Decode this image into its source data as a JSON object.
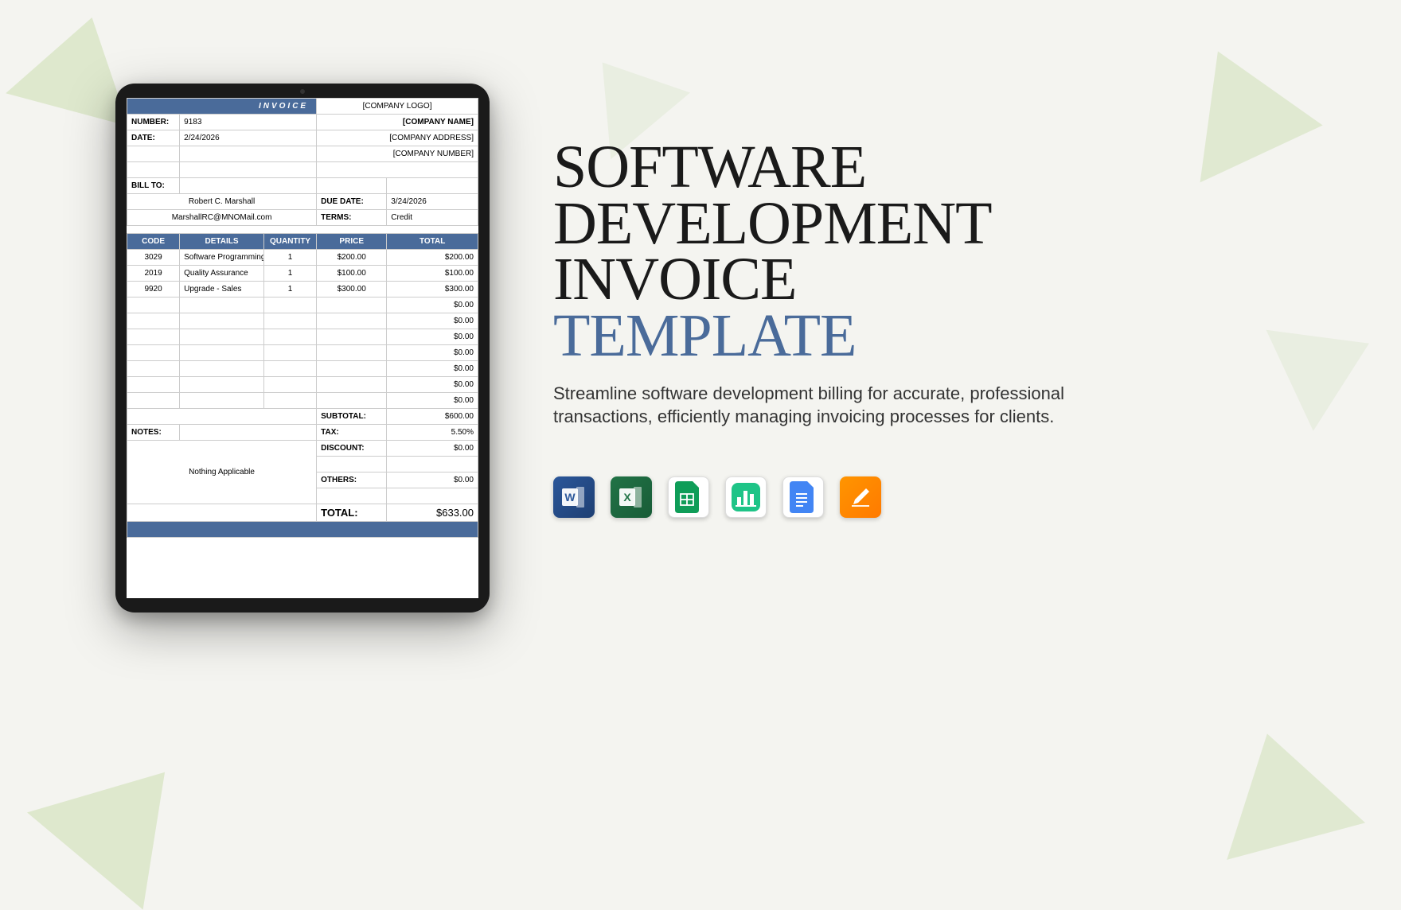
{
  "invoice": {
    "header_label": "INVOICE",
    "company_logo_placeholder": "[COMPANY LOGO]",
    "company_name_placeholder": "[COMPANY NAME]",
    "company_address_placeholder": "[COMPANY ADDRESS]",
    "company_number_placeholder": "[COMPANY NUMBER]",
    "number_label": "NUMBER:",
    "number_value": "9183",
    "date_label": "DATE:",
    "date_value": "2/24/2026",
    "bill_to_label": "BILL TO:",
    "bill_to_name": "Robert C. Marshall",
    "bill_to_email": "MarshallRC@MNOMail.com",
    "due_date_label": "DUE DATE:",
    "due_date_value": "3/24/2026",
    "terms_label": "TERMS:",
    "terms_value": "Credit",
    "columns": {
      "code": "CODE",
      "details": "DETAILS",
      "quantity": "QUANTITY",
      "price": "PRICE",
      "total": "TOTAL"
    },
    "items": [
      {
        "code": "3029",
        "details": "Software Programming",
        "qty": "1",
        "price": "$200.00",
        "total": "$200.00"
      },
      {
        "code": "2019",
        "details": "Quality Assurance",
        "qty": "1",
        "price": "$100.00",
        "total": "$100.00"
      },
      {
        "code": "9920",
        "details": "Upgrade - Sales",
        "qty": "1",
        "price": "$300.00",
        "total": "$300.00"
      }
    ],
    "empty_total": "$0.00",
    "subtotal_label": "SUBTOTAL:",
    "subtotal_value": "$600.00",
    "tax_label": "TAX:",
    "tax_value": "5.50%",
    "discount_label": "DISCOUNT:",
    "discount_value": "$0.00",
    "others_label": "OTHERS:",
    "others_value": "$0.00",
    "notes_label": "NOTES:",
    "notes_value": "Nothing Applicable",
    "total_label": "TOTAL:",
    "total_value": "$633.00"
  },
  "marketing": {
    "title_line1": "SOFTWARE",
    "title_line2": "DEVELOPMENT",
    "title_line3": "INVOICE",
    "title_line4": "TEMPLATE",
    "description": "Streamline software development billing for accurate, professional transactions, efficiently managing invoicing processes for clients."
  },
  "formats": {
    "word": "W",
    "excel": "X",
    "sheets": "sheets",
    "numbers": "numbers",
    "docs": "docs",
    "pages": "pages"
  }
}
